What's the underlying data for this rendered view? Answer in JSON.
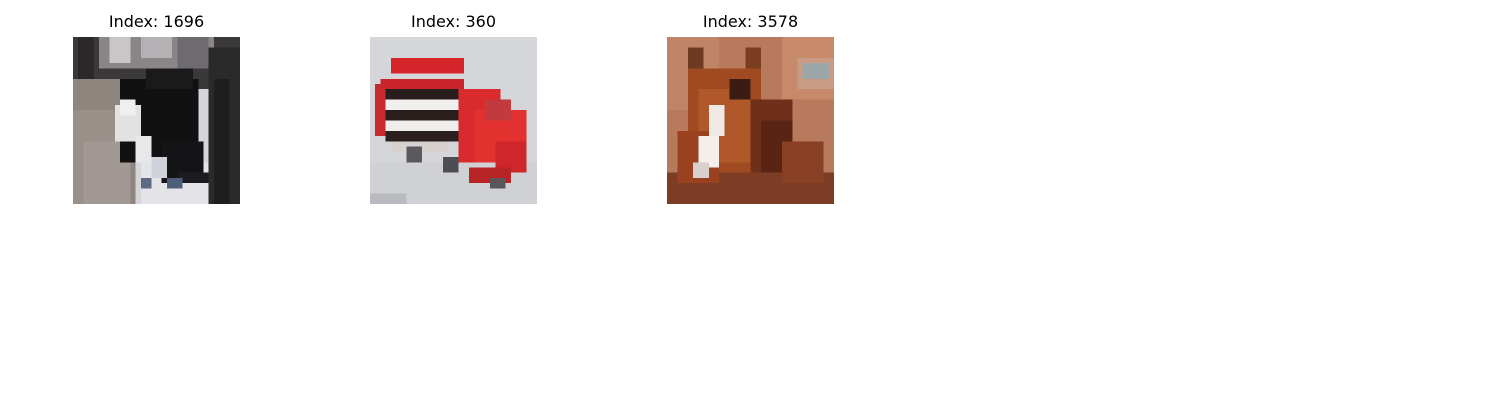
{
  "panels": [
    {
      "title": "Index: 1696",
      "subject": "cat"
    },
    {
      "title": "Index: 360",
      "subject": "truck"
    },
    {
      "title": "Index: 3578",
      "subject": "horse"
    }
  ]
}
